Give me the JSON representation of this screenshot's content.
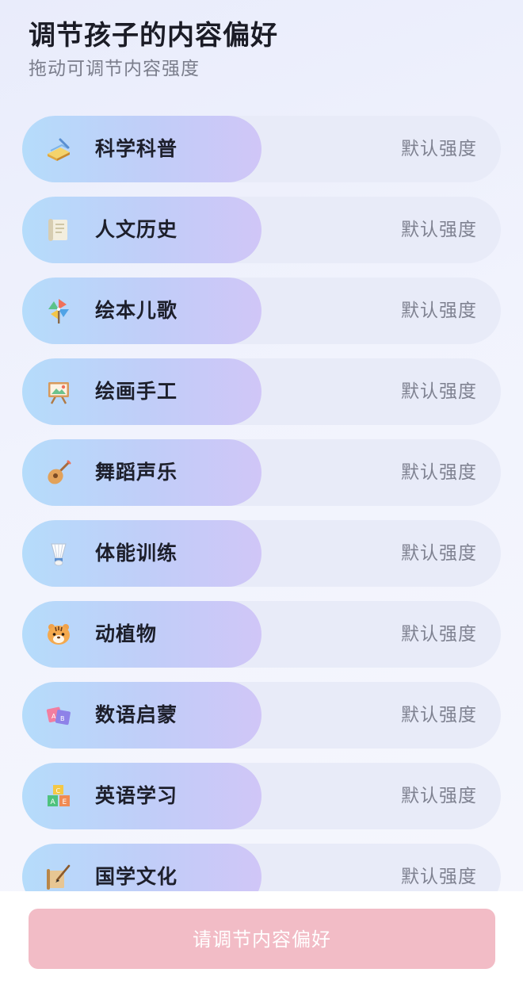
{
  "header": {
    "title": "调节孩子的内容偏好",
    "subtitle": "拖动可调节内容强度"
  },
  "preferences": [
    {
      "label": "科学科普",
      "level_text": "默认强度",
      "icon": "book-pen-icon",
      "level": 0.5
    },
    {
      "label": "人文历史",
      "level_text": "默认强度",
      "icon": "scroll-icon",
      "level": 0.5
    },
    {
      "label": "绘本儿歌",
      "level_text": "默认强度",
      "icon": "pinwheel-icon",
      "level": 0.5
    },
    {
      "label": "绘画手工",
      "level_text": "默认强度",
      "icon": "easel-icon",
      "level": 0.5
    },
    {
      "label": "舞蹈声乐",
      "level_text": "默认强度",
      "icon": "guitar-icon",
      "level": 0.5
    },
    {
      "label": "体能训练",
      "level_text": "默认强度",
      "icon": "shuttlecock-icon",
      "level": 0.5
    },
    {
      "label": "动植物",
      "level_text": "默认强度",
      "icon": "tiger-icon",
      "level": 0.5
    },
    {
      "label": "数语启蒙",
      "level_text": "默认强度",
      "icon": "letter-cards-icon",
      "level": 0.5
    },
    {
      "label": "英语学习",
      "level_text": "默认强度",
      "icon": "abc-blocks-icon",
      "level": 0.5
    },
    {
      "label": "国学文化",
      "level_text": "默认强度",
      "icon": "brush-scroll-icon",
      "level": 0.5
    }
  ],
  "footer": {
    "submit_label": "请调节内容偏好"
  },
  "colors": {
    "fill_start": "#b5dcfb",
    "fill_end": "#d0c6f7",
    "track": "#e8ebf8",
    "submit_disabled": "#f2bcc6"
  }
}
